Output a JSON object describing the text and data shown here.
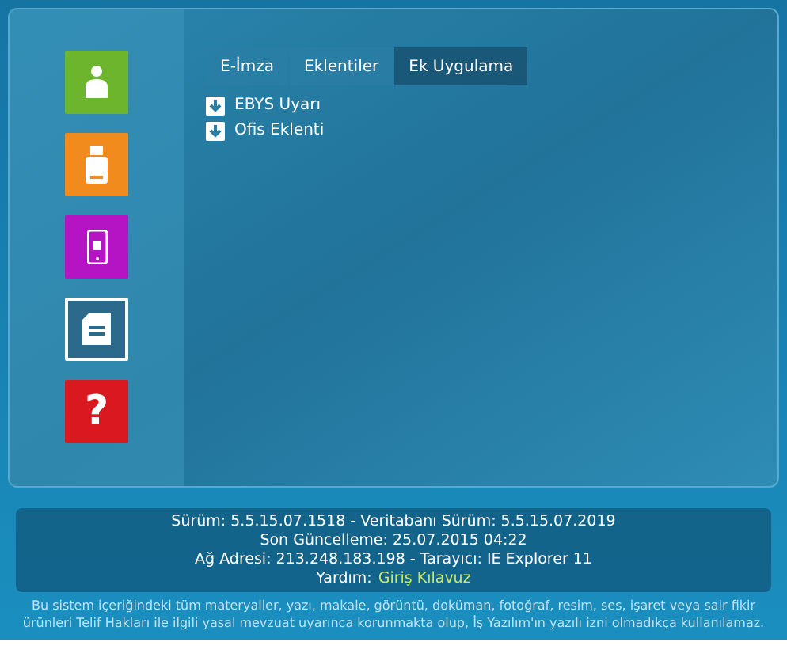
{
  "sidebar": {
    "tiles": [
      {
        "kind": "person",
        "color": "#6cb52d",
        "selected": false
      },
      {
        "kind": "usb",
        "color": "#f28b1e",
        "selected": false
      },
      {
        "kind": "phone",
        "color": "#b414c4",
        "selected": false
      },
      {
        "kind": "document",
        "color": "#2b6a8a",
        "selected": true
      },
      {
        "kind": "help",
        "color": "#d9191f",
        "selected": false,
        "glyph": "?"
      }
    ]
  },
  "tabs": [
    {
      "label": "E-İmza",
      "selected": false
    },
    {
      "label": "Eklentiler",
      "selected": false
    },
    {
      "label": "Ek Uygulama",
      "selected": true
    }
  ],
  "downloads": [
    "EBYS Uyarı",
    "Ofis Eklenti"
  ],
  "info": {
    "lines": [
      "Sürüm: 5.5.15.07.1518 - Veritabanı Sürüm: 5.5.15.07.2019",
      "Son Güncelleme: 25.07.2015 04:22",
      "Ağ Adresi: 213.248.183.198 - Tarayıcı: IE Explorer 11"
    ],
    "help_label": "Yardım:",
    "help_link": "Giriş Kılavuz"
  },
  "footer": "Bu sistem içeriğindeki tüm materyaller, yazı, makale, görüntü, doküman, fotoğraf, resim, ses, işaret veya sair fikir ürünleri Telif Hakları ile ilgili yasal mevzuat uyarınca korunmakta olup, İş Yazılım'ın yazılı izni olmadıkça kullanılamaz."
}
